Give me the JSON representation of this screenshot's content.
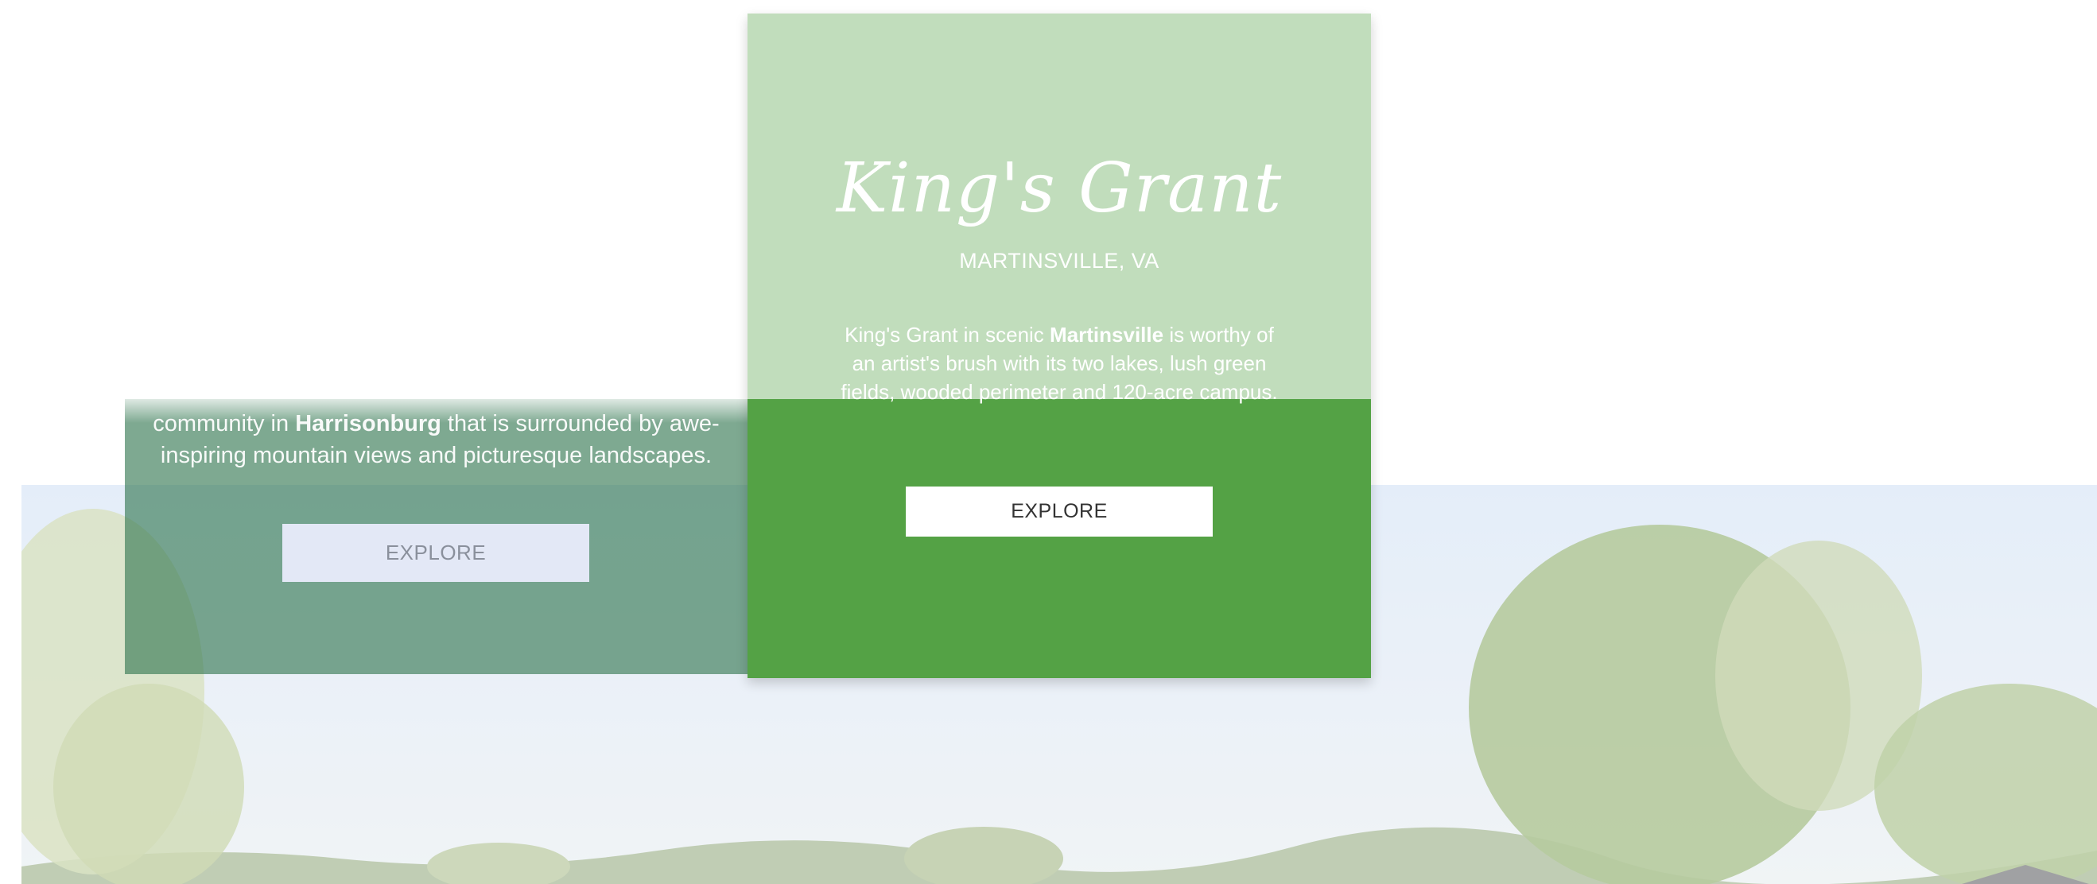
{
  "communities": {
    "left": {
      "description_before": "community in ",
      "description_bold": "Harrisonburg",
      "description_after": " that is surrounded by awe-inspiring mountain views and picturesque landscapes.",
      "button_label": "EXPLORE"
    },
    "center": {
      "name": "King's Grant",
      "location": "MARTINSVILLE, VA",
      "description_before": "King's Grant in scenic ",
      "description_bold": "Martinsville",
      "description_after": " is worthy of an artist's brush with its two lakes, lush green fields, wooded perimeter and 120-acre campus.",
      "button_label": "EXPLORE"
    }
  },
  "colors": {
    "center_card": "#54a245",
    "left_card": "#2e744e",
    "button_bg": "#ffffff"
  },
  "background": {
    "icon": "landscape-photo"
  }
}
